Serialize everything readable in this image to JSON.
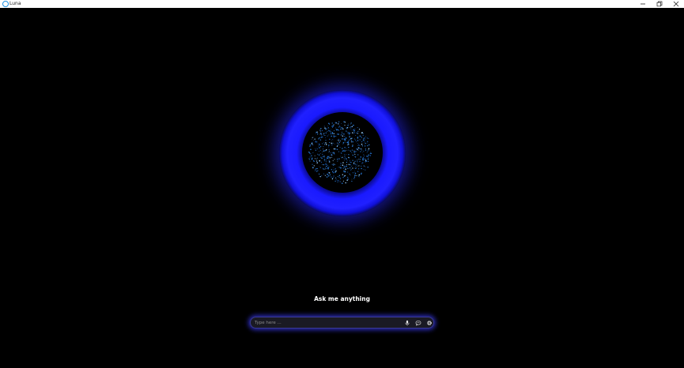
{
  "window": {
    "title": "Luna",
    "icons": {
      "app": "luna-ring-icon",
      "minimize": "minimize-icon",
      "maximize": "restore-icon",
      "close": "close-icon"
    }
  },
  "main": {
    "prompt": "Ask me anything"
  },
  "input": {
    "placeholder": "Type here ...",
    "value": "",
    "actions": [
      {
        "name": "microphone",
        "icon": "microphone-icon"
      },
      {
        "name": "chat",
        "icon": "chat-bubble-icon"
      },
      {
        "name": "settings",
        "icon": "gear-icon"
      }
    ]
  },
  "colors": {
    "background": "#000000",
    "orb_glow": "#2020ff",
    "input_glow": "#3c3cff",
    "app_icon": "#1e8fe0"
  }
}
